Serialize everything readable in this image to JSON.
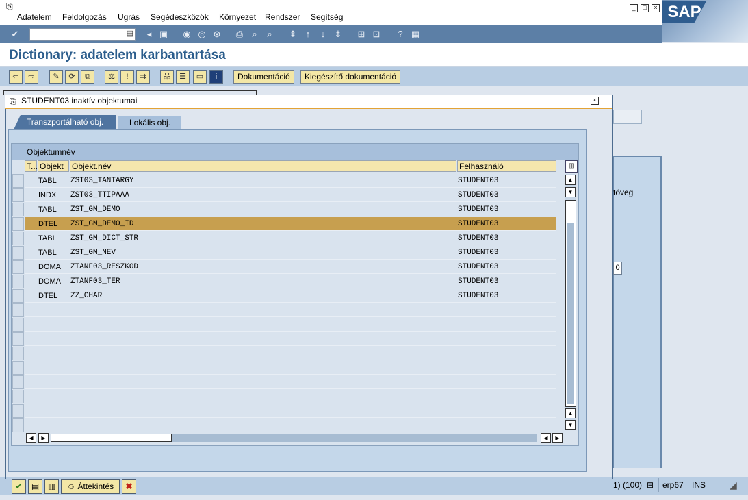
{
  "menubar": {
    "items": [
      "Adatelem",
      "Feldolgozás",
      "Ugrás",
      "Segédeszközök",
      "Környezet",
      "Rendszer",
      "Segítség"
    ]
  },
  "sap": {
    "logo": "SAP"
  },
  "page": {
    "title": "Dictionary: adatelem karbantartása"
  },
  "toolbar": {
    "doc_label": "Dokumentáció",
    "extra_doc_label": "Kiegészítő dokumentáció"
  },
  "background": {
    "text_fragment": "töveg",
    "small_value": "0"
  },
  "popup": {
    "title": "STUDENT03 inaktív objektumai",
    "tabs": [
      "Transzportálható obj.",
      "Lokális obj."
    ],
    "grid_title": "Objektumnév",
    "columns": [
      "T...",
      "Objekt",
      "Objekt.név",
      "Felhasználó"
    ],
    "rows": [
      {
        "type": "TABL",
        "name": "ZST03_TANTARGY",
        "user": "STUDENT03",
        "selected": false
      },
      {
        "type": "INDX",
        "name": "ZST03_TTIPAAA",
        "user": "STUDENT03",
        "selected": false
      },
      {
        "type": "TABL",
        "name": "ZST_GM_DEMO",
        "user": "STUDENT03",
        "selected": false
      },
      {
        "type": "DTEL",
        "name": "ZST_GM_DEMO_ID",
        "user": "STUDENT03",
        "selected": true
      },
      {
        "type": "TABL",
        "name": "ZST_GM_DICT_STR",
        "user": "STUDENT03",
        "selected": false
      },
      {
        "type": "TABL",
        "name": "ZST_GM_NEV",
        "user": "STUDENT03",
        "selected": false
      },
      {
        "type": "DOMA",
        "name": "ZTANF03_RESZKOD",
        "user": "STUDENT03",
        "selected": false
      },
      {
        "type": "DOMA",
        "name": "ZTANF03_TER",
        "user": "STUDENT03",
        "selected": false
      },
      {
        "type": "DTEL",
        "name": "ZZ_CHAR",
        "user": "STUDENT03",
        "selected": false
      }
    ],
    "footer": {
      "overview_label": "Áttekintés"
    }
  },
  "statusbar": {
    "session": "1) (100)",
    "server": "erp67",
    "mode": "INS"
  },
  "colors": {
    "accent": "#e3a335",
    "selected_row": "#c79f4f",
    "title_blue": "#2b5d8c"
  }
}
